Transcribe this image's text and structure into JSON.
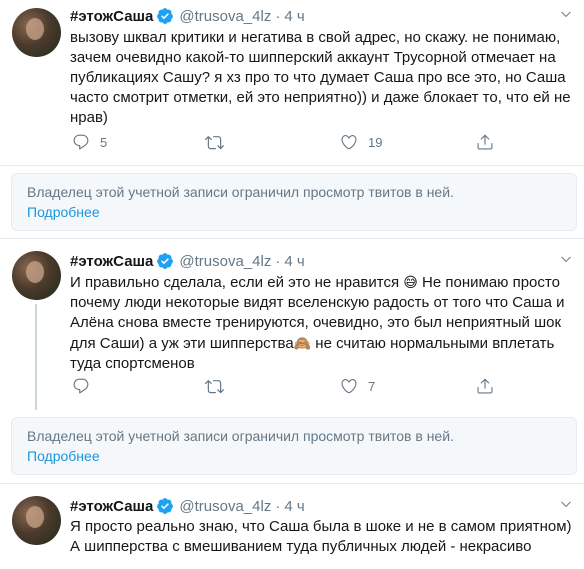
{
  "tweets": [
    {
      "name": "#этожСаша",
      "handle": "@trusova_4lz",
      "time": "4 ч",
      "text": "вызову шквал критики и негатива в свой адрес, но скажу. не понимаю, зачем очевидно какой-то шипперский аккаунт Трусорной отмечает на публикациях Сашу? я хз про то что думает Саша про все это, но Саша часто смотрит отметки, ей это неприятно)) и даже блокает то, что ей не нрав)",
      "reply_count": "5",
      "retweet_count": "",
      "like_count": "19"
    },
    {
      "name": "#этожСаша",
      "handle": "@trusova_4lz",
      "time": "4 ч",
      "text_parts": [
        "И правильно сделала, если ей это не нравится ",
        "😅",
        " Не понимаю просто почему люди некоторые видят вселенскую радость от того что Саша и Алёна снова вместе тренируются, очевидно, это был неприятный шок для Саши) а уж эти шипперства",
        "🙈",
        " не считаю нормальными вплетать туда спортсменов"
      ],
      "reply_count": "",
      "retweet_count": "",
      "like_count": "7"
    },
    {
      "name": "#этожСаша",
      "handle": "@trusova_4lz",
      "time": "4 ч",
      "text": "Я просто реально знаю, что Саша была в шоке и не в самом приятном) А шипперства с вмешиванием туда публичных людей - некрасиво"
    }
  ],
  "notices": [
    {
      "text": "Владелец этой учетной записи ограничил просмотр твитов в ней.",
      "link": "Подробнее"
    },
    {
      "text": "Владелец этой учетной записи ограничил просмотр твитов в ней.",
      "link": "Подробнее"
    }
  ],
  "colors": {
    "accent": "#1da1f2",
    "link": "#1b95e0",
    "muted": "#657786",
    "thread": "#ccd6dd"
  },
  "icons": [
    "verified-badge-icon",
    "reply-icon",
    "retweet-icon",
    "like-icon",
    "share-icon",
    "caret-down-icon"
  ]
}
